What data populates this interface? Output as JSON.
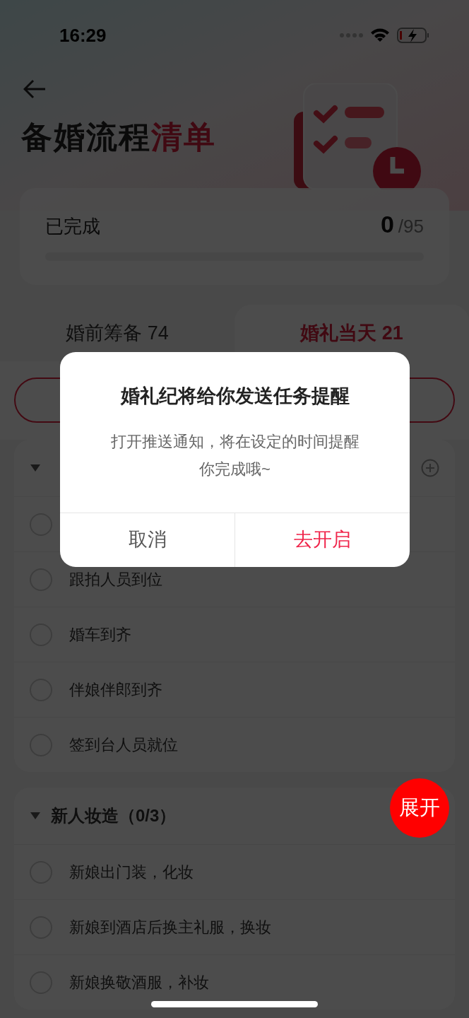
{
  "status_bar": {
    "time": "16:29"
  },
  "header": {
    "title": "备婚流程",
    "title_highlight": "清单"
  },
  "progress": {
    "label": "已完成",
    "done": "0",
    "total": "/95",
    "level": 0
  },
  "tabs": [
    {
      "label": "婚前筹备",
      "count": "74",
      "selected": false
    },
    {
      "label": "婚礼当天",
      "count": "21",
      "selected": true
    }
  ],
  "sections": [
    {
      "expanded": true,
      "items": [
        {
          "checked": false
        },
        {
          "label": "跟拍人员到位",
          "checked": false
        },
        {
          "label": "婚车到齐",
          "checked": false
        },
        {
          "label": "伴娘伴郎到齐",
          "checked": false
        },
        {
          "label": "签到台人员就位",
          "checked": false
        }
      ]
    },
    {
      "title": "新人妆造（0/3）",
      "expanded": true,
      "items": [
        {
          "label": "新娘出门装，化妆",
          "checked": false
        },
        {
          "label": "新娘到酒店后换主礼服，换妆",
          "checked": false
        },
        {
          "label": "新娘换敬酒服，补妆",
          "checked": false
        }
      ]
    }
  ],
  "fab": {
    "label": "展开"
  },
  "dialog": {
    "title": "婚礼纪将给你发送任务提醒",
    "message": "打开推送通知，将在设定的时间提醒你完成哦~",
    "buttons": [
      {
        "label": "取消",
        "kind": "cancel"
      },
      {
        "label": "去开启",
        "kind": "confirm"
      }
    ]
  }
}
